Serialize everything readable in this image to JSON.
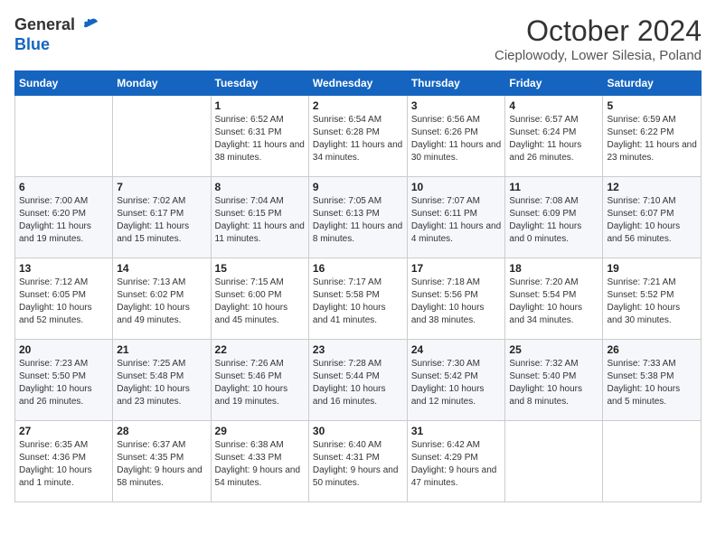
{
  "header": {
    "logo_general": "General",
    "logo_blue": "Blue",
    "month_title": "October 2024",
    "location": "Cieplowody, Lower Silesia, Poland"
  },
  "days_of_week": [
    "Sunday",
    "Monday",
    "Tuesday",
    "Wednesday",
    "Thursday",
    "Friday",
    "Saturday"
  ],
  "weeks": [
    [
      {
        "day": "",
        "sunrise": "",
        "sunset": "",
        "daylight": ""
      },
      {
        "day": "",
        "sunrise": "",
        "sunset": "",
        "daylight": ""
      },
      {
        "day": "1",
        "sunrise": "Sunrise: 6:52 AM",
        "sunset": "Sunset: 6:31 PM",
        "daylight": "Daylight: 11 hours and 38 minutes."
      },
      {
        "day": "2",
        "sunrise": "Sunrise: 6:54 AM",
        "sunset": "Sunset: 6:28 PM",
        "daylight": "Daylight: 11 hours and 34 minutes."
      },
      {
        "day": "3",
        "sunrise": "Sunrise: 6:56 AM",
        "sunset": "Sunset: 6:26 PM",
        "daylight": "Daylight: 11 hours and 30 minutes."
      },
      {
        "day": "4",
        "sunrise": "Sunrise: 6:57 AM",
        "sunset": "Sunset: 6:24 PM",
        "daylight": "Daylight: 11 hours and 26 minutes."
      },
      {
        "day": "5",
        "sunrise": "Sunrise: 6:59 AM",
        "sunset": "Sunset: 6:22 PM",
        "daylight": "Daylight: 11 hours and 23 minutes."
      }
    ],
    [
      {
        "day": "6",
        "sunrise": "Sunrise: 7:00 AM",
        "sunset": "Sunset: 6:20 PM",
        "daylight": "Daylight: 11 hours and 19 minutes."
      },
      {
        "day": "7",
        "sunrise": "Sunrise: 7:02 AM",
        "sunset": "Sunset: 6:17 PM",
        "daylight": "Daylight: 11 hours and 15 minutes."
      },
      {
        "day": "8",
        "sunrise": "Sunrise: 7:04 AM",
        "sunset": "Sunset: 6:15 PM",
        "daylight": "Daylight: 11 hours and 11 minutes."
      },
      {
        "day": "9",
        "sunrise": "Sunrise: 7:05 AM",
        "sunset": "Sunset: 6:13 PM",
        "daylight": "Daylight: 11 hours and 8 minutes."
      },
      {
        "day": "10",
        "sunrise": "Sunrise: 7:07 AM",
        "sunset": "Sunset: 6:11 PM",
        "daylight": "Daylight: 11 hours and 4 minutes."
      },
      {
        "day": "11",
        "sunrise": "Sunrise: 7:08 AM",
        "sunset": "Sunset: 6:09 PM",
        "daylight": "Daylight: 11 hours and 0 minutes."
      },
      {
        "day": "12",
        "sunrise": "Sunrise: 7:10 AM",
        "sunset": "Sunset: 6:07 PM",
        "daylight": "Daylight: 10 hours and 56 minutes."
      }
    ],
    [
      {
        "day": "13",
        "sunrise": "Sunrise: 7:12 AM",
        "sunset": "Sunset: 6:05 PM",
        "daylight": "Daylight: 10 hours and 52 minutes."
      },
      {
        "day": "14",
        "sunrise": "Sunrise: 7:13 AM",
        "sunset": "Sunset: 6:02 PM",
        "daylight": "Daylight: 10 hours and 49 minutes."
      },
      {
        "day": "15",
        "sunrise": "Sunrise: 7:15 AM",
        "sunset": "Sunset: 6:00 PM",
        "daylight": "Daylight: 10 hours and 45 minutes."
      },
      {
        "day": "16",
        "sunrise": "Sunrise: 7:17 AM",
        "sunset": "Sunset: 5:58 PM",
        "daylight": "Daylight: 10 hours and 41 minutes."
      },
      {
        "day": "17",
        "sunrise": "Sunrise: 7:18 AM",
        "sunset": "Sunset: 5:56 PM",
        "daylight": "Daylight: 10 hours and 38 minutes."
      },
      {
        "day": "18",
        "sunrise": "Sunrise: 7:20 AM",
        "sunset": "Sunset: 5:54 PM",
        "daylight": "Daylight: 10 hours and 34 minutes."
      },
      {
        "day": "19",
        "sunrise": "Sunrise: 7:21 AM",
        "sunset": "Sunset: 5:52 PM",
        "daylight": "Daylight: 10 hours and 30 minutes."
      }
    ],
    [
      {
        "day": "20",
        "sunrise": "Sunrise: 7:23 AM",
        "sunset": "Sunset: 5:50 PM",
        "daylight": "Daylight: 10 hours and 26 minutes."
      },
      {
        "day": "21",
        "sunrise": "Sunrise: 7:25 AM",
        "sunset": "Sunset: 5:48 PM",
        "daylight": "Daylight: 10 hours and 23 minutes."
      },
      {
        "day": "22",
        "sunrise": "Sunrise: 7:26 AM",
        "sunset": "Sunset: 5:46 PM",
        "daylight": "Daylight: 10 hours and 19 minutes."
      },
      {
        "day": "23",
        "sunrise": "Sunrise: 7:28 AM",
        "sunset": "Sunset: 5:44 PM",
        "daylight": "Daylight: 10 hours and 16 minutes."
      },
      {
        "day": "24",
        "sunrise": "Sunrise: 7:30 AM",
        "sunset": "Sunset: 5:42 PM",
        "daylight": "Daylight: 10 hours and 12 minutes."
      },
      {
        "day": "25",
        "sunrise": "Sunrise: 7:32 AM",
        "sunset": "Sunset: 5:40 PM",
        "daylight": "Daylight: 10 hours and 8 minutes."
      },
      {
        "day": "26",
        "sunrise": "Sunrise: 7:33 AM",
        "sunset": "Sunset: 5:38 PM",
        "daylight": "Daylight: 10 hours and 5 minutes."
      }
    ],
    [
      {
        "day": "27",
        "sunrise": "Sunrise: 6:35 AM",
        "sunset": "Sunset: 4:36 PM",
        "daylight": "Daylight: 10 hours and 1 minute."
      },
      {
        "day": "28",
        "sunrise": "Sunrise: 6:37 AM",
        "sunset": "Sunset: 4:35 PM",
        "daylight": "Daylight: 9 hours and 58 minutes."
      },
      {
        "day": "29",
        "sunrise": "Sunrise: 6:38 AM",
        "sunset": "Sunset: 4:33 PM",
        "daylight": "Daylight: 9 hours and 54 minutes."
      },
      {
        "day": "30",
        "sunrise": "Sunrise: 6:40 AM",
        "sunset": "Sunset: 4:31 PM",
        "daylight": "Daylight: 9 hours and 50 minutes."
      },
      {
        "day": "31",
        "sunrise": "Sunrise: 6:42 AM",
        "sunset": "Sunset: 4:29 PM",
        "daylight": "Daylight: 9 hours and 47 minutes."
      },
      {
        "day": "",
        "sunrise": "",
        "sunset": "",
        "daylight": ""
      },
      {
        "day": "",
        "sunrise": "",
        "sunset": "",
        "daylight": ""
      }
    ]
  ]
}
